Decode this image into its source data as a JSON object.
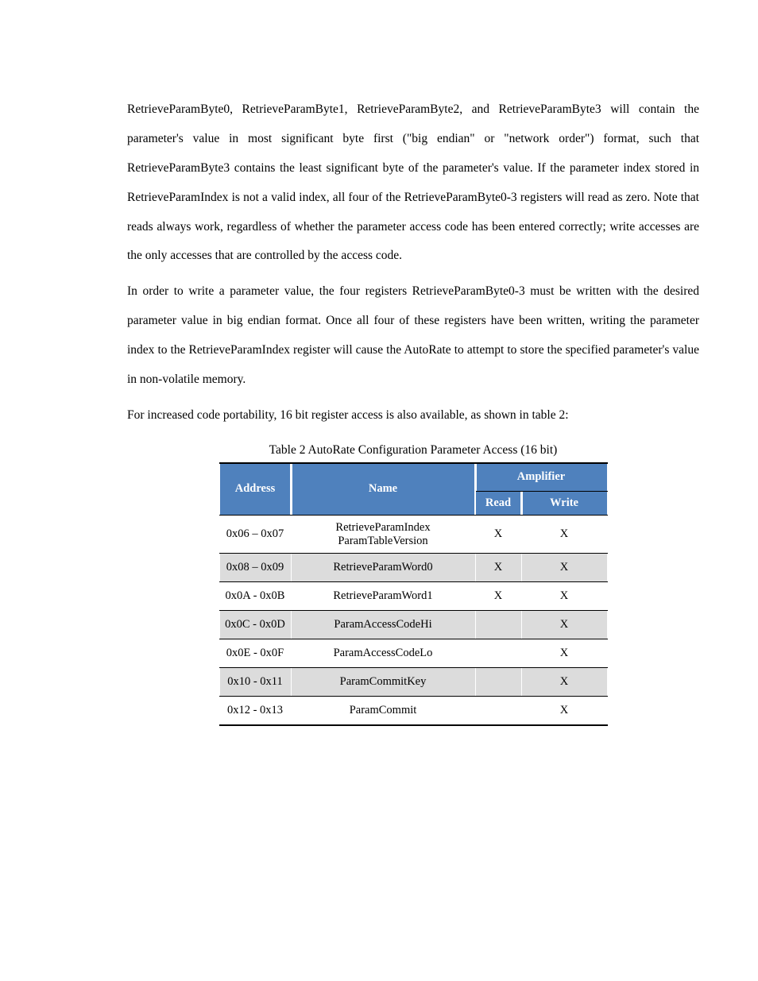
{
  "paragraphs": {
    "p1_a": "RetrieveParamByte0, RetrieveParamByte1, RetrieveParamByte2, and RetrieveParamByte3 will",
    "p1_b": "contain the parameter's value in most significant byte first (\"big endian\" or \"network order\")",
    "p1_c": "format, such that RetrieveParamByte3 contains the least significant byte of the parameter's",
    "p1_d": "value. If the parameter index stored in RetrieveParamIndex is not a valid index, all four of the",
    "p1_e": "RetrieveParamByte0-3 registers will read as zero. Note that reads always work, regardless of",
    "p1_f": "whether the parameter access code has been entered correctly; write accesses are the only",
    "p1_g": "accesses that are controlled by the access code.",
    "p2_a": "In order to write a parameter value, the four registers RetrieveParamByte0-3 must be written",
    "p2_b": "with the desired parameter value in big endian format. Once all four of these registers have",
    "p2_c": "been written, writing the parameter index to the RetrieveParamIndex register will cause the",
    "p2_d": "AutoRate to attempt to store the specified parameter's value in non-volatile memory.",
    "p3": "For increased code portability, 16 bit register access is also available, as shown in table 2:"
  },
  "table": {
    "caption": "Table 2 AutoRate Configuration Parameter Access (16 bit)",
    "headers": {
      "address": "Address",
      "name": "Name",
      "amplifier": "Amplifier",
      "read": "Read",
      "write": "Write"
    },
    "rows": [
      {
        "address": "0x06 – 0x07",
        "name_l1": "RetrieveParamIndex",
        "name_l2": "ParamTableVersion",
        "read": "X",
        "write": "X"
      },
      {
        "address": "0x08 – 0x09",
        "name_l1": "RetrieveParamWord0",
        "name_l2": "",
        "read": "X",
        "write": "X"
      },
      {
        "address": "0x0A - 0x0B",
        "name_l1": "RetrieveParamWord1",
        "name_l2": "",
        "read": "X",
        "write": "X"
      },
      {
        "address": "0x0C - 0x0D",
        "name_l1": "ParamAccessCodeHi",
        "name_l2": "",
        "read": "",
        "write": "X"
      },
      {
        "address": "0x0E - 0x0F",
        "name_l1": "ParamAccessCodeLo",
        "name_l2": "",
        "read": "",
        "write": "X"
      },
      {
        "address": "0x10 - 0x11",
        "name_l1": "ParamCommitKey",
        "name_l2": "",
        "read": "",
        "write": "X"
      },
      {
        "address": "0x12 - 0x13",
        "name_l1": "ParamCommit",
        "name_l2": "",
        "read": "",
        "write": "X"
      }
    ]
  }
}
